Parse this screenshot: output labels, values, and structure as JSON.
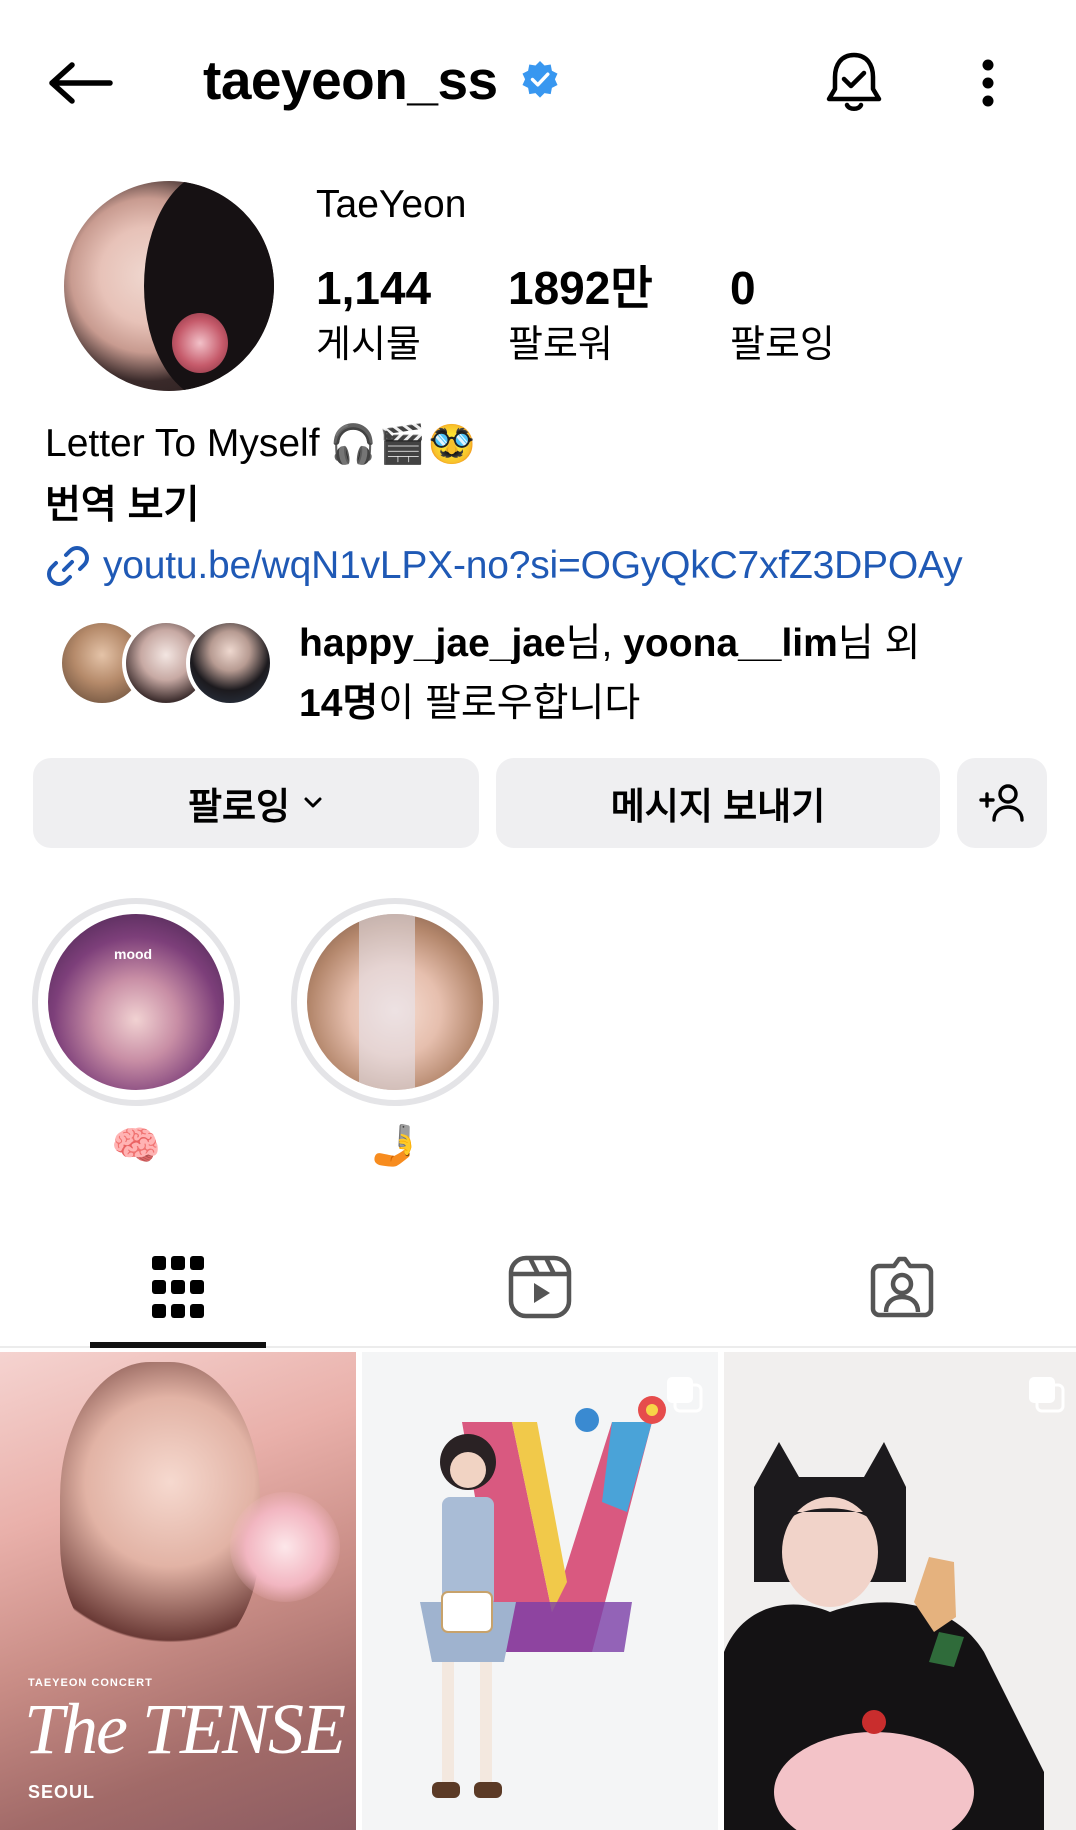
{
  "header": {
    "username": "taeyeon_ss",
    "icons": {
      "back": "back-arrow-icon",
      "verified": "verified-badge-icon",
      "notify": "bell-check-icon",
      "more": "more-vertical-icon"
    },
    "accent": "#3897f0"
  },
  "profile": {
    "display_name": "TaeYeon",
    "stats": [
      {
        "value": "1,144",
        "label": "게시물"
      },
      {
        "value": "1892만",
        "label": "팔로워"
      },
      {
        "value": "0",
        "label": "팔로잉"
      }
    ],
    "bio": "Letter To Myself",
    "bio_emoji": "🎧🎬🥸",
    "translate_label": "번역 보기",
    "link": "youtu.be/wqN1vLPX-no?si=OGyQkC7xfZ3DPOAy",
    "link_color": "#1f59b5",
    "mutual": {
      "user1": "happy_jae_jae",
      "suffix1": "님, ",
      "user2": "yoona__lim",
      "suffix2": "님 외",
      "count": "14명",
      "tail": "이 팔로우합니다"
    }
  },
  "actions": {
    "following_label": "팔로잉",
    "message_label": "메시지 보내기",
    "add_person_icon": "add-person-icon"
  },
  "highlights": [
    {
      "label": "🧠",
      "image_text": "mood"
    },
    {
      "label": "🤳"
    }
  ],
  "tabs": [
    {
      "name": "posts-grid",
      "icon": "grid-icon",
      "active": true
    },
    {
      "name": "reels",
      "icon": "reels-icon",
      "active": false
    },
    {
      "name": "tagged",
      "icon": "tagged-person-icon",
      "active": false
    }
  ],
  "posts": {
    "poster": {
      "subtitle": "TAEYEON CONCERT",
      "title": "The TENSE",
      "city": "SEOUL"
    }
  }
}
